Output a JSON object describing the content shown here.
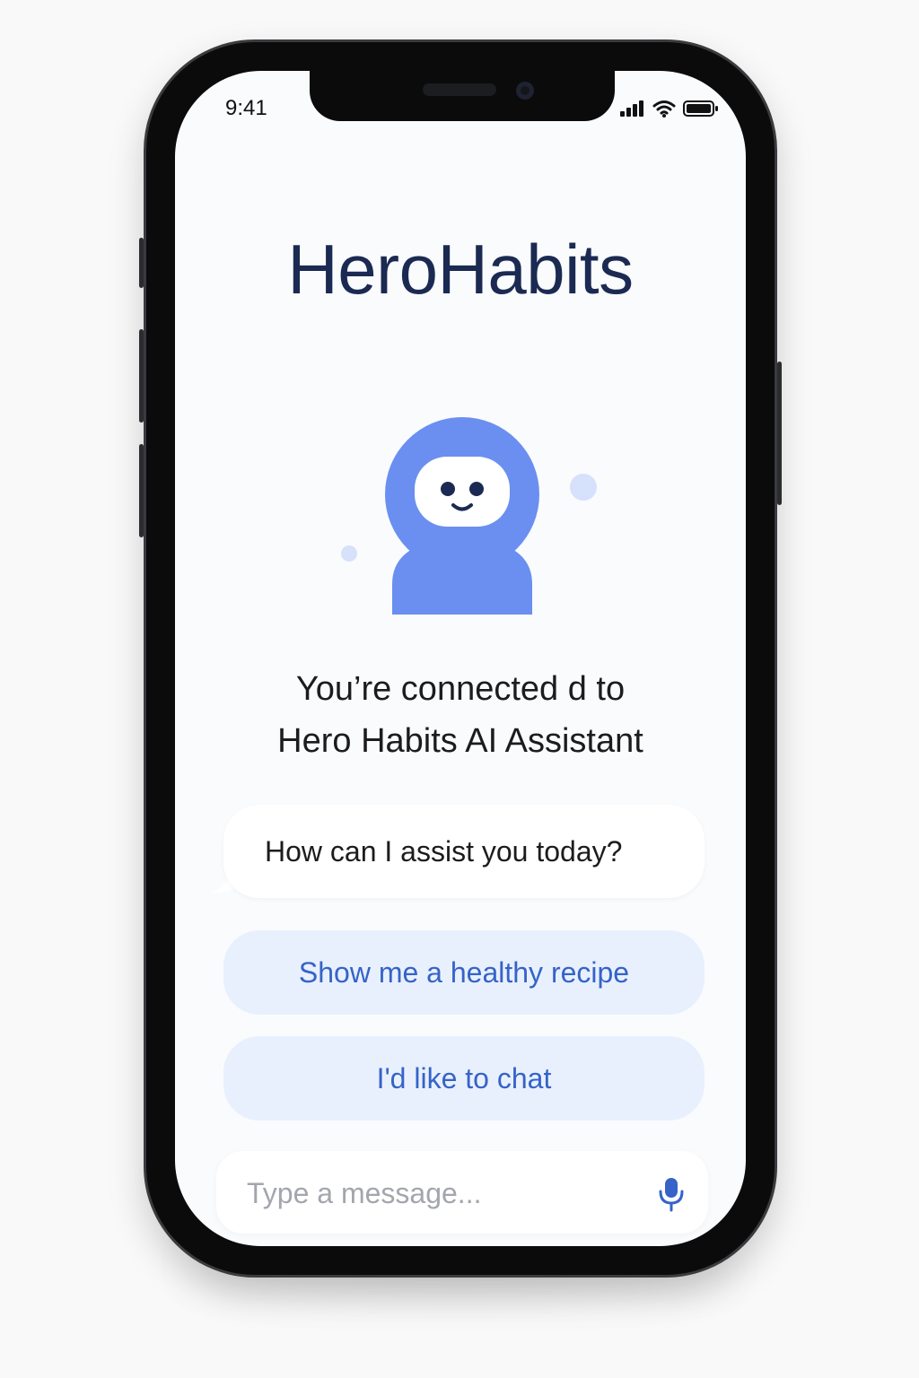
{
  "status_bar": {
    "time": "9:41",
    "icons": [
      "cellular-signal-icon",
      "wifi-icon",
      "battery-icon"
    ]
  },
  "app": {
    "title": "HeroHabits",
    "mascot_icon": "robot-mascot-icon"
  },
  "connection": {
    "line1": "You’re connected d to",
    "line2": "Hero Habits AI Assistant"
  },
  "chat": {
    "assistant_message": "How can I assist you today?",
    "suggestions": [
      "Show me a healthy recipe",
      "I'd like to chat"
    ]
  },
  "composer": {
    "value": "",
    "placeholder": "Type a message...",
    "mic_icon": "microphone-icon"
  },
  "colors": {
    "brand_navy": "#1b2a52",
    "accent_blue": "#3563c8",
    "mascot_blue": "#6b8ff0",
    "suggestion_bg": "#e9f0fd"
  }
}
